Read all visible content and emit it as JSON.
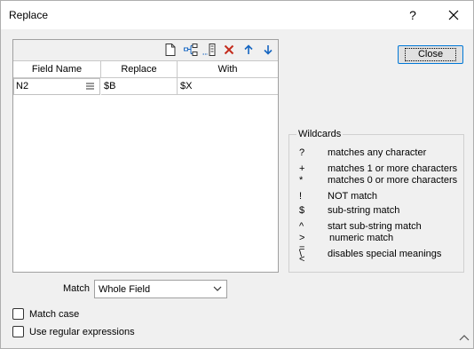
{
  "window": {
    "title": "Replace",
    "help_label": "?"
  },
  "toolbar": {
    "icons": [
      "new-page-icon",
      "field-tree-icon",
      "insert-field-icon",
      "delete-icon",
      "move-up-icon",
      "move-down-icon"
    ],
    "delete_color": "#c42b1c",
    "arrow_color": "#1565c0"
  },
  "grid": {
    "headers": [
      "Field Name",
      "Replace",
      "With"
    ],
    "rows": [
      {
        "field": "N2",
        "replace": "$B",
        "with": "$X"
      }
    ]
  },
  "close_button": {
    "label": "Close"
  },
  "wildcards": {
    "legend": "Wildcards",
    "items": [
      {
        "symbol": "?",
        "desc": "matches any character"
      },
      {
        "symbol": "+",
        "desc": "matches 1 or more characters"
      },
      {
        "symbol": "*",
        "desc": "matches 0 or more characters"
      },
      {
        "symbol": "!",
        "desc": "NOT match"
      },
      {
        "symbol": "$",
        "desc": "sub-string match"
      },
      {
        "symbol": "^",
        "desc": "start sub-string match"
      },
      {
        "symbol": "> = <",
        "desc": "numeric match"
      },
      {
        "symbol": "\\",
        "desc": "disables special meanings"
      }
    ]
  },
  "match": {
    "label": "Match",
    "value": "Whole Field"
  },
  "options": {
    "match_case": {
      "label": "Match case",
      "checked": false
    },
    "regex": {
      "label": "Use regular expressions",
      "checked": false
    }
  }
}
